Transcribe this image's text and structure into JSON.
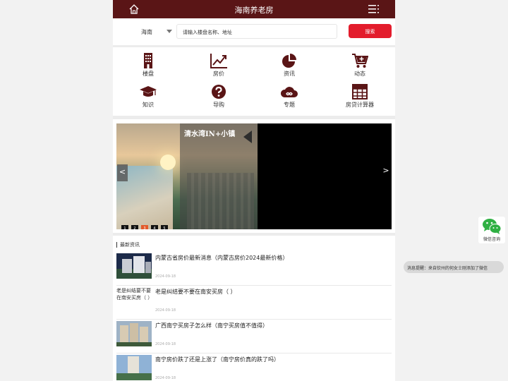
{
  "header": {
    "title": "海南养老房",
    "home_icon": "home-icon",
    "menu_icon": "menu-icon",
    "color": "#5a1516"
  },
  "search": {
    "city": "海南",
    "placeholder": "请输入楼盘名称、地址",
    "button": "搜索",
    "button_color": "#e31c2c"
  },
  "nav": [
    {
      "label": "楼盘",
      "icon": "building-icon"
    },
    {
      "label": "房价",
      "icon": "line-chart-icon"
    },
    {
      "label": "资讯",
      "icon": "pie-chart-icon"
    },
    {
      "label": "动态",
      "icon": "cart-plus-icon"
    },
    {
      "label": "知识",
      "icon": "graduation-cap-icon"
    },
    {
      "label": "导购",
      "icon": "question-icon"
    },
    {
      "label": "专题",
      "icon": "infinity-cloud-icon"
    },
    {
      "label": "房贷计算器",
      "icon": "calculator-grid-icon"
    }
  ],
  "banner": {
    "caption": "清水湾IN+小镇",
    "prev": "<",
    "next": ">",
    "pages": [
      "1",
      "2",
      "3",
      "4",
      "5"
    ],
    "active_page": "3"
  },
  "news": {
    "heading": "最新资讯",
    "items": [
      {
        "title": "内蒙古省房价最新消息（内蒙古房价2024最新价格）",
        "date": "2024-09-18"
      },
      {
        "title": "老是纠结要不要在南安买房（ ）",
        "date": "2024-09-18",
        "thumb_alt": "老是纠结要不要在南安买房（ ）"
      },
      {
        "title": "广西南宁买房子怎么样（南宁买房值不值得）",
        "date": "2024-09-18"
      },
      {
        "title": "南宁房价跌了还是上涨了（南宁房价真的跌了吗）",
        "date": "2024-09-18"
      }
    ]
  },
  "wechat": {
    "label": "微信咨询",
    "icon": "wechat-icon"
  },
  "toast": {
    "text": "消息提醒：来自钦州的何女士刚添加了微信"
  }
}
